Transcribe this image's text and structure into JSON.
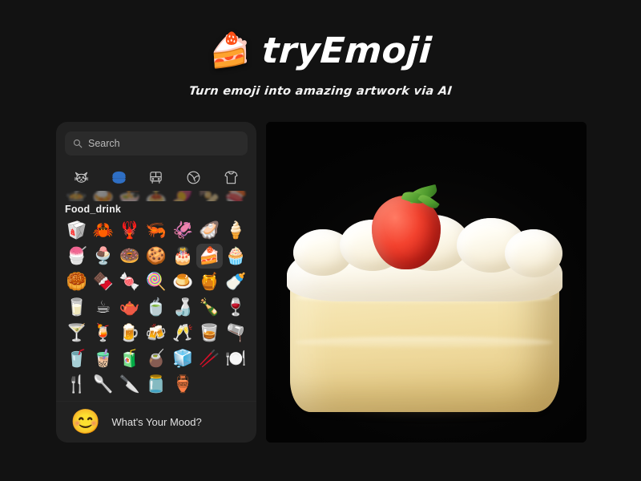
{
  "header": {
    "brand_emoji": "🍰",
    "brand_emoji_name": "shortcake-icon",
    "title": "tryEmoji",
    "tagline": "Turn emoji into amazing artwork via AI"
  },
  "colors": {
    "page_background": "#121212",
    "panel_background": "#212121",
    "search_background": "#2b2b2b",
    "accent_selected": "#2f6fc4",
    "cell_selected": "#3a3a3a",
    "text_primary": "#e8e8e8",
    "text_muted": "#b9b9b9"
  },
  "picker": {
    "search": {
      "placeholder": "Search",
      "value": "",
      "icon": "search-icon"
    },
    "categories": [
      {
        "id": "animals_nature",
        "icon": "cat-face-icon",
        "selected": false
      },
      {
        "id": "food_drink",
        "icon": "hamburger-icon",
        "selected": true
      },
      {
        "id": "travel_places",
        "icon": "bus-icon",
        "selected": false
      },
      {
        "id": "activities",
        "icon": "ball-icon",
        "selected": false
      },
      {
        "id": "objects",
        "icon": "t-shirt-icon",
        "selected": false
      }
    ],
    "peek_row": [
      "🍲",
      "🍛",
      "🍜",
      "🍝",
      "🍠",
      "🍢",
      "🍣"
    ],
    "group_label": "Food_drink",
    "emoji_rows": [
      [
        {
          "char": "🥡",
          "name": "takeout-box",
          "selected": false
        },
        {
          "char": "🦀",
          "name": "crab",
          "selected": false
        },
        {
          "char": "🦞",
          "name": "lobster",
          "selected": false
        },
        {
          "char": "🦐",
          "name": "shrimp",
          "selected": false
        },
        {
          "char": "🦑",
          "name": "squid",
          "selected": false
        },
        {
          "char": "🦪",
          "name": "oyster",
          "selected": false
        },
        {
          "char": "🍦",
          "name": "soft-ice-cream",
          "selected": false
        }
      ],
      [
        {
          "char": "🍧",
          "name": "shaved-ice",
          "selected": false
        },
        {
          "char": "🍨",
          "name": "ice-cream",
          "selected": false
        },
        {
          "char": "🍩",
          "name": "doughnut",
          "selected": false
        },
        {
          "char": "🍪",
          "name": "cookie",
          "selected": false
        },
        {
          "char": "🎂",
          "name": "birthday-cake",
          "selected": false
        },
        {
          "char": "🍰",
          "name": "shortcake",
          "selected": true
        },
        {
          "char": "🧁",
          "name": "cupcake",
          "selected": false
        }
      ],
      [
        {
          "char": "🥮",
          "name": "moon-cake",
          "selected": false
        },
        {
          "char": "🍫",
          "name": "chocolate-bar",
          "selected": false
        },
        {
          "char": "🍬",
          "name": "candy",
          "selected": false
        },
        {
          "char": "🍭",
          "name": "lollipop",
          "selected": false
        },
        {
          "char": "🍮",
          "name": "custard",
          "selected": false
        },
        {
          "char": "🍯",
          "name": "honey-pot",
          "selected": false
        },
        {
          "char": "🍼",
          "name": "baby-bottle",
          "selected": false
        }
      ],
      [
        {
          "char": "🥛",
          "name": "glass-of-milk",
          "selected": false
        },
        {
          "char": "☕",
          "name": "hot-beverage",
          "selected": false
        },
        {
          "char": "🫖",
          "name": "teapot",
          "selected": false
        },
        {
          "char": "🍵",
          "name": "teacup-without-handle",
          "selected": false
        },
        {
          "char": "🍶",
          "name": "sake",
          "selected": false
        },
        {
          "char": "🍾",
          "name": "bottle-with-popping-cork",
          "selected": false
        },
        {
          "char": "🍷",
          "name": "wine-glass",
          "selected": false
        }
      ],
      [
        {
          "char": "🍸",
          "name": "cocktail-glass",
          "selected": false
        },
        {
          "char": "🍹",
          "name": "tropical-drink",
          "selected": false
        },
        {
          "char": "🍺",
          "name": "beer-mug",
          "selected": false
        },
        {
          "char": "🍻",
          "name": "clinking-beer-mugs",
          "selected": false
        },
        {
          "char": "🥂",
          "name": "clinking-glasses",
          "selected": false
        },
        {
          "char": "🥃",
          "name": "tumbler-glass",
          "selected": false
        },
        {
          "char": "🫗",
          "name": "pouring-liquid",
          "selected": false
        }
      ],
      [
        {
          "char": "🥤",
          "name": "cup-with-straw",
          "selected": false
        },
        {
          "char": "🧋",
          "name": "bubble-tea",
          "selected": false
        },
        {
          "char": "🧃",
          "name": "beverage-box",
          "selected": false
        },
        {
          "char": "🧉",
          "name": "mate",
          "selected": false
        },
        {
          "char": "🧊",
          "name": "ice",
          "selected": false
        },
        {
          "char": "🥢",
          "name": "chopsticks",
          "selected": false
        },
        {
          "char": "🍽️",
          "name": "fork-knife-with-plate",
          "selected": false
        }
      ],
      [
        {
          "char": "🍴",
          "name": "fork-and-knife",
          "selected": false
        },
        {
          "char": "🥄",
          "name": "spoon",
          "selected": false
        },
        {
          "char": "🔪",
          "name": "kitchen-knife",
          "selected": false
        },
        {
          "char": "🫙",
          "name": "jar",
          "selected": false
        },
        {
          "char": "🏺",
          "name": "amphora",
          "selected": false
        }
      ]
    ],
    "mood": {
      "emoji": "😊",
      "emoji_name": "smiling-face-icon",
      "label": "What's Your Mood?"
    }
  },
  "preview": {
    "alt": "AI generated photo of a strawberry shortcake slice on a black background"
  }
}
